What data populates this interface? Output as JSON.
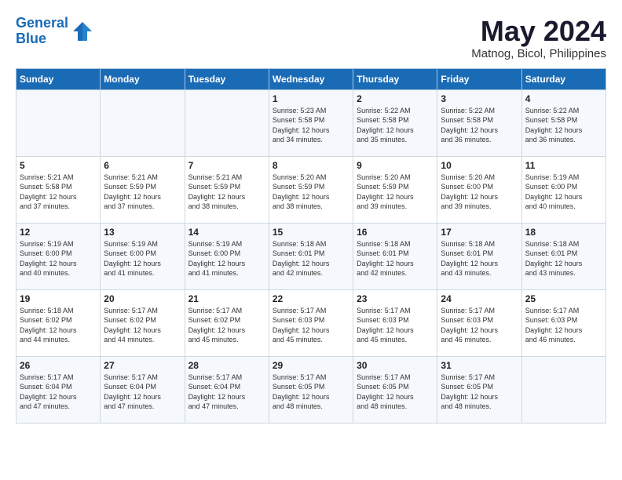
{
  "header": {
    "logo_line1": "General",
    "logo_line2": "Blue",
    "main_title": "May 2024",
    "sub_title": "Matnog, Bicol, Philippines"
  },
  "weekdays": [
    "Sunday",
    "Monday",
    "Tuesday",
    "Wednesday",
    "Thursday",
    "Friday",
    "Saturday"
  ],
  "weeks": [
    [
      {
        "day": "",
        "info": ""
      },
      {
        "day": "",
        "info": ""
      },
      {
        "day": "",
        "info": ""
      },
      {
        "day": "1",
        "info": "Sunrise: 5:23 AM\nSunset: 5:58 PM\nDaylight: 12 hours\nand 34 minutes."
      },
      {
        "day": "2",
        "info": "Sunrise: 5:22 AM\nSunset: 5:58 PM\nDaylight: 12 hours\nand 35 minutes."
      },
      {
        "day": "3",
        "info": "Sunrise: 5:22 AM\nSunset: 5:58 PM\nDaylight: 12 hours\nand 36 minutes."
      },
      {
        "day": "4",
        "info": "Sunrise: 5:22 AM\nSunset: 5:58 PM\nDaylight: 12 hours\nand 36 minutes."
      }
    ],
    [
      {
        "day": "5",
        "info": "Sunrise: 5:21 AM\nSunset: 5:58 PM\nDaylight: 12 hours\nand 37 minutes."
      },
      {
        "day": "6",
        "info": "Sunrise: 5:21 AM\nSunset: 5:59 PM\nDaylight: 12 hours\nand 37 minutes."
      },
      {
        "day": "7",
        "info": "Sunrise: 5:21 AM\nSunset: 5:59 PM\nDaylight: 12 hours\nand 38 minutes."
      },
      {
        "day": "8",
        "info": "Sunrise: 5:20 AM\nSunset: 5:59 PM\nDaylight: 12 hours\nand 38 minutes."
      },
      {
        "day": "9",
        "info": "Sunrise: 5:20 AM\nSunset: 5:59 PM\nDaylight: 12 hours\nand 39 minutes."
      },
      {
        "day": "10",
        "info": "Sunrise: 5:20 AM\nSunset: 6:00 PM\nDaylight: 12 hours\nand 39 minutes."
      },
      {
        "day": "11",
        "info": "Sunrise: 5:19 AM\nSunset: 6:00 PM\nDaylight: 12 hours\nand 40 minutes."
      }
    ],
    [
      {
        "day": "12",
        "info": "Sunrise: 5:19 AM\nSunset: 6:00 PM\nDaylight: 12 hours\nand 40 minutes."
      },
      {
        "day": "13",
        "info": "Sunrise: 5:19 AM\nSunset: 6:00 PM\nDaylight: 12 hours\nand 41 minutes."
      },
      {
        "day": "14",
        "info": "Sunrise: 5:19 AM\nSunset: 6:00 PM\nDaylight: 12 hours\nand 41 minutes."
      },
      {
        "day": "15",
        "info": "Sunrise: 5:18 AM\nSunset: 6:01 PM\nDaylight: 12 hours\nand 42 minutes."
      },
      {
        "day": "16",
        "info": "Sunrise: 5:18 AM\nSunset: 6:01 PM\nDaylight: 12 hours\nand 42 minutes."
      },
      {
        "day": "17",
        "info": "Sunrise: 5:18 AM\nSunset: 6:01 PM\nDaylight: 12 hours\nand 43 minutes."
      },
      {
        "day": "18",
        "info": "Sunrise: 5:18 AM\nSunset: 6:01 PM\nDaylight: 12 hours\nand 43 minutes."
      }
    ],
    [
      {
        "day": "19",
        "info": "Sunrise: 5:18 AM\nSunset: 6:02 PM\nDaylight: 12 hours\nand 44 minutes."
      },
      {
        "day": "20",
        "info": "Sunrise: 5:17 AM\nSunset: 6:02 PM\nDaylight: 12 hours\nand 44 minutes."
      },
      {
        "day": "21",
        "info": "Sunrise: 5:17 AM\nSunset: 6:02 PM\nDaylight: 12 hours\nand 45 minutes."
      },
      {
        "day": "22",
        "info": "Sunrise: 5:17 AM\nSunset: 6:03 PM\nDaylight: 12 hours\nand 45 minutes."
      },
      {
        "day": "23",
        "info": "Sunrise: 5:17 AM\nSunset: 6:03 PM\nDaylight: 12 hours\nand 45 minutes."
      },
      {
        "day": "24",
        "info": "Sunrise: 5:17 AM\nSunset: 6:03 PM\nDaylight: 12 hours\nand 46 minutes."
      },
      {
        "day": "25",
        "info": "Sunrise: 5:17 AM\nSunset: 6:03 PM\nDaylight: 12 hours\nand 46 minutes."
      }
    ],
    [
      {
        "day": "26",
        "info": "Sunrise: 5:17 AM\nSunset: 6:04 PM\nDaylight: 12 hours\nand 47 minutes."
      },
      {
        "day": "27",
        "info": "Sunrise: 5:17 AM\nSunset: 6:04 PM\nDaylight: 12 hours\nand 47 minutes."
      },
      {
        "day": "28",
        "info": "Sunrise: 5:17 AM\nSunset: 6:04 PM\nDaylight: 12 hours\nand 47 minutes."
      },
      {
        "day": "29",
        "info": "Sunrise: 5:17 AM\nSunset: 6:05 PM\nDaylight: 12 hours\nand 48 minutes."
      },
      {
        "day": "30",
        "info": "Sunrise: 5:17 AM\nSunset: 6:05 PM\nDaylight: 12 hours\nand 48 minutes."
      },
      {
        "day": "31",
        "info": "Sunrise: 5:17 AM\nSunset: 6:05 PM\nDaylight: 12 hours\nand 48 minutes."
      },
      {
        "day": "",
        "info": ""
      }
    ]
  ]
}
